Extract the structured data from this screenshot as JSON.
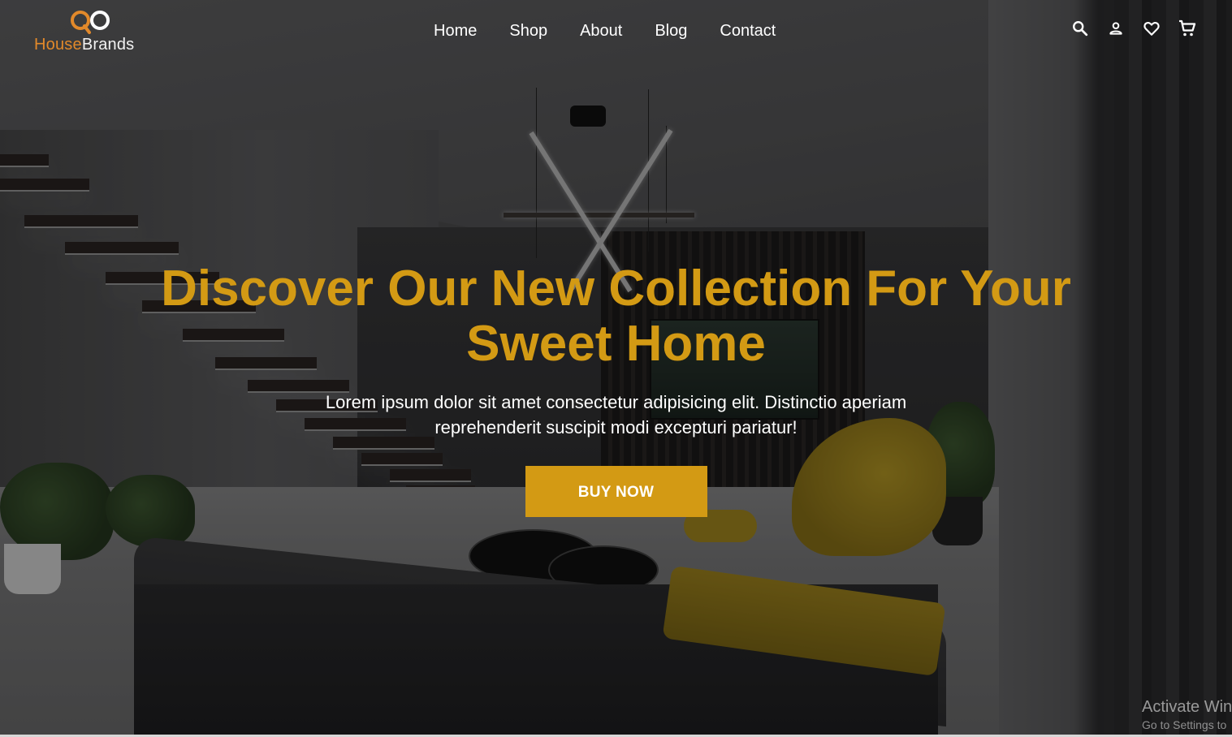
{
  "brand": {
    "name_part1": "House",
    "name_part2": "Brands",
    "accent_color": "#e2892a"
  },
  "nav": {
    "items": [
      {
        "label": "Home"
      },
      {
        "label": "Shop"
      },
      {
        "label": "About"
      },
      {
        "label": "Blog"
      },
      {
        "label": "Contact"
      }
    ]
  },
  "header_icons": [
    "search-icon",
    "user-icon",
    "heart-icon",
    "cart-icon"
  ],
  "hero": {
    "title": "Discover Our New Collection For Your Sweet Home",
    "subtitle": "Lorem ipsum dolor sit amet consectetur adipisicing elit. Distinctio aperiam reprehenderit suscipit modi excepturi pariatur!",
    "cta_label": "BUY NOW",
    "accent_color": "#d39a14"
  },
  "watermark": {
    "title": "Activate Win",
    "subtitle": "Go to Settings to"
  }
}
